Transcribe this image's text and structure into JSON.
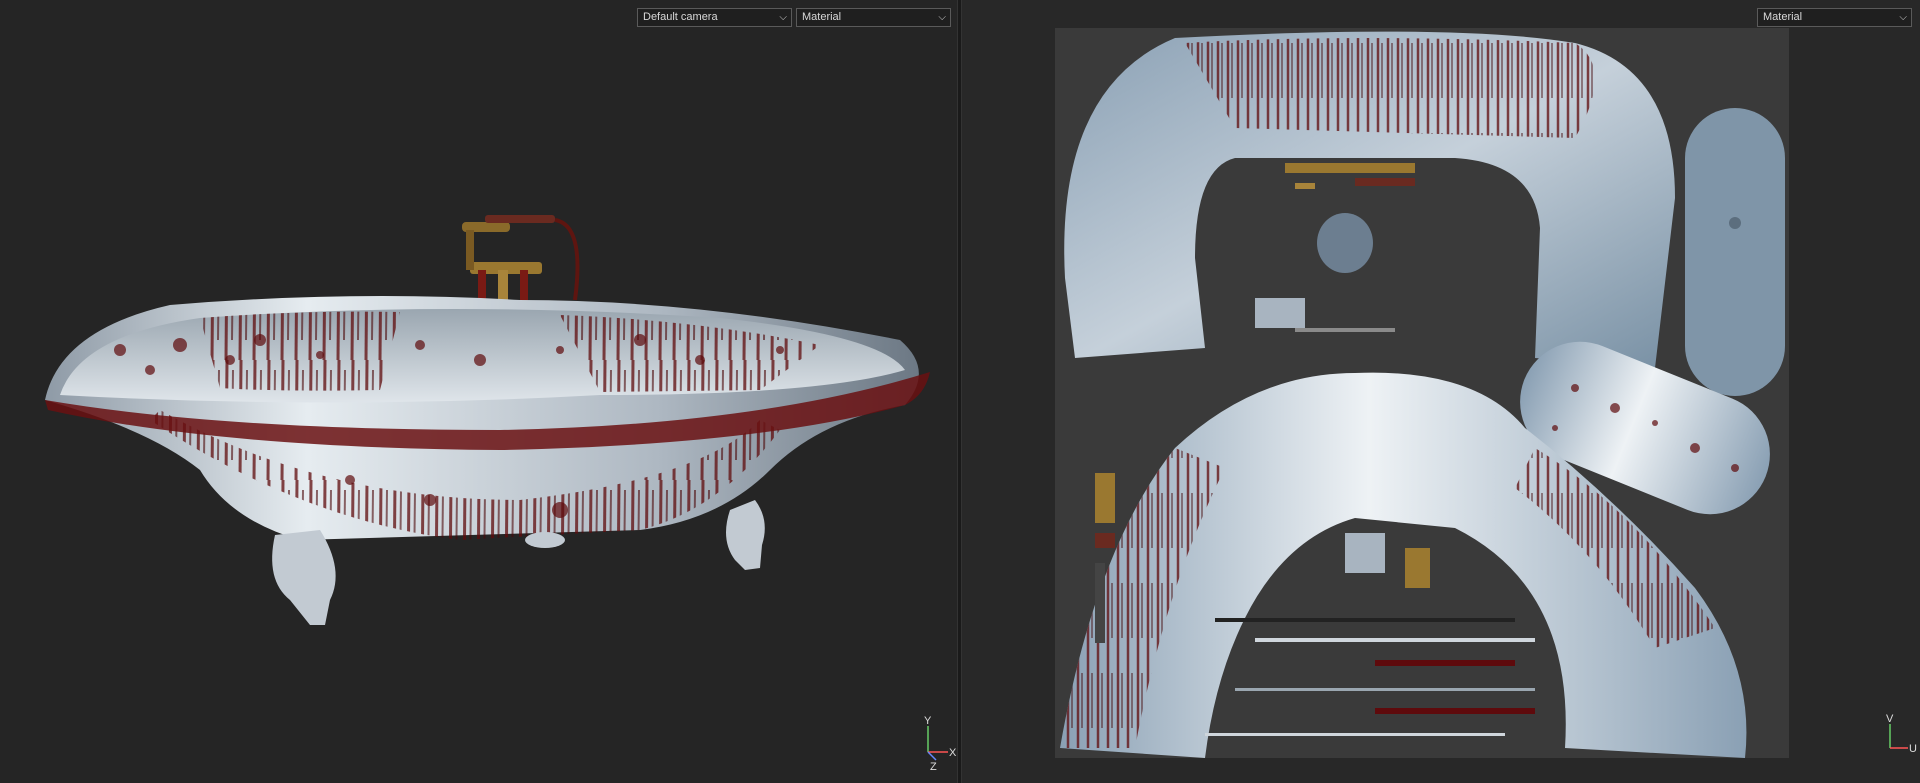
{
  "viewport_3d": {
    "camera_select": {
      "value": "Default camera"
    },
    "material_select": {
      "value": "Material"
    },
    "axes": {
      "y": "Y",
      "x": "X",
      "z": "Z"
    }
  },
  "viewport_uv": {
    "material_select": {
      "value": "Material"
    },
    "axes": {
      "v": "V",
      "u": "U"
    }
  },
  "icons": [
    "chevron-down-icon",
    "axis-gizmo-icon"
  ],
  "colors": {
    "background": "#252525",
    "uv_sheet": "#3a3a3a",
    "porcelain": "#c9d2da",
    "blood": "#5e0a0c",
    "brass": "#8a6a2a"
  }
}
